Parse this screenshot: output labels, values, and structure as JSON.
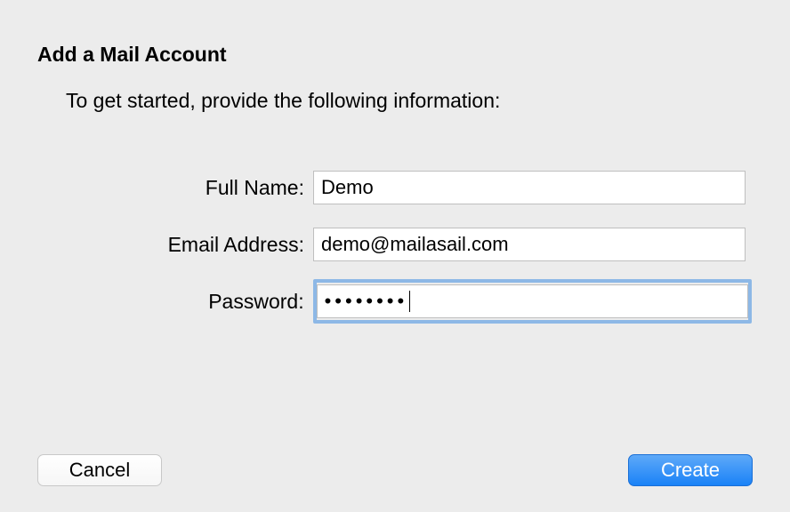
{
  "dialog": {
    "title": "Add a Mail Account",
    "subtitle": "To get started, provide the following information:"
  },
  "fields": {
    "full_name": {
      "label": "Full Name:",
      "value": "Demo"
    },
    "email": {
      "label": "Email Address:",
      "value": "demo@mailasail.com"
    },
    "password": {
      "label": "Password:",
      "masked": "••••••••"
    }
  },
  "buttons": {
    "cancel": "Cancel",
    "create": "Create"
  }
}
